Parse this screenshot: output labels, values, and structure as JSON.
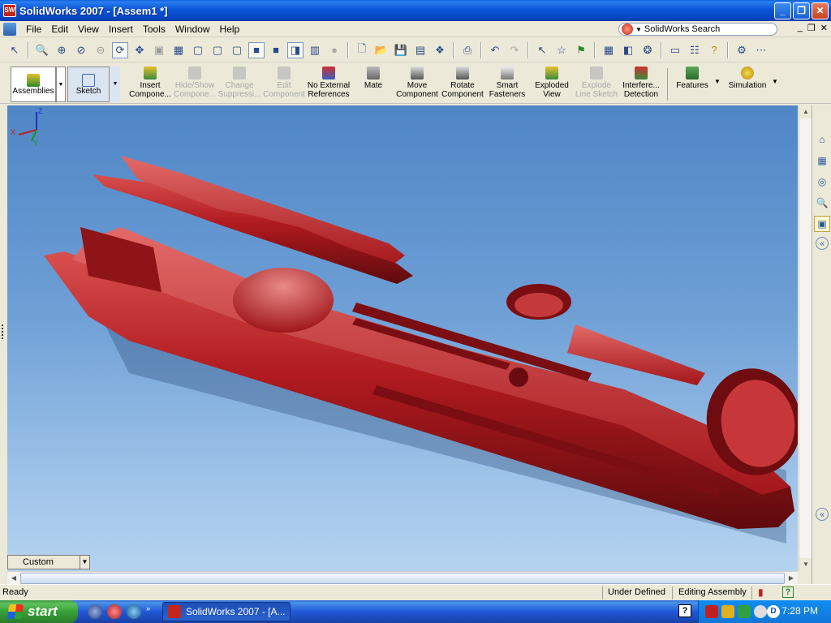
{
  "window": {
    "title": "SolidWorks 2007 - [Assem1 *]",
    "app_icon_text": "SW"
  },
  "menu": {
    "items": [
      "File",
      "Edit",
      "View",
      "Insert",
      "Tools",
      "Window",
      "Help"
    ],
    "search_label": "SolidWorks Search"
  },
  "command_manager": {
    "tabs": [
      {
        "label": "Assemblies"
      },
      {
        "label": "Sketch"
      }
    ],
    "buttons": [
      {
        "line1": "Insert",
        "line2": "Compone...",
        "enabled": true
      },
      {
        "line1": "Hide/Show",
        "line2": "Compone...",
        "enabled": false
      },
      {
        "line1": "Change",
        "line2": "Suppressi...",
        "enabled": false
      },
      {
        "line1": "Edit",
        "line2": "Component",
        "enabled": false
      },
      {
        "line1": "No External",
        "line2": "References",
        "enabled": true
      },
      {
        "line1": "Mate",
        "line2": "",
        "enabled": true
      },
      {
        "line1": "Move",
        "line2": "Component",
        "enabled": true
      },
      {
        "line1": "Rotate",
        "line2": "Component",
        "enabled": true
      },
      {
        "line1": "Smart",
        "line2": "Fasteners",
        "enabled": true
      },
      {
        "line1": "Exploded",
        "line2": "View",
        "enabled": true
      },
      {
        "line1": "Explode",
        "line2": "Line Sketch",
        "enabled": false
      },
      {
        "line1": "Interfere...",
        "line2": "Detection",
        "enabled": true
      },
      {
        "line1": "Features",
        "line2": "",
        "enabled": true
      },
      {
        "line1": "Simulation",
        "line2": "",
        "enabled": true
      }
    ]
  },
  "viewport": {
    "view_orientation": "Custom",
    "triad_labels": {
      "z": "Z",
      "x": "X",
      "y": "Y"
    },
    "part_color": "#b01a1f",
    "background_top": "#4f86c6",
    "background_bottom": "#b5d3f0"
  },
  "status": {
    "left": "Ready",
    "definition": "Under Defined",
    "mode": "Editing Assembly",
    "help_label": "?"
  },
  "taskbar": {
    "start_label": "start",
    "task_item": "SolidWorks 2007 - [A...",
    "clock": "7:28 PM",
    "help_label": "?"
  }
}
